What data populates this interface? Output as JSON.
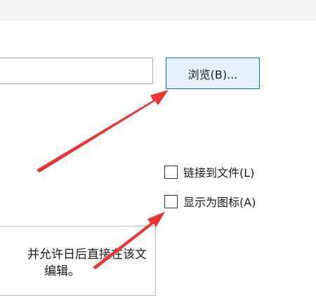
{
  "file_input": {
    "value": ""
  },
  "browse_button": {
    "label": "浏览(B)..."
  },
  "options": [
    {
      "label": "链接到文件(L)",
      "checked": false
    },
    {
      "label": "显示为图标(A)",
      "checked": false
    }
  ],
  "result": {
    "line1": "并允许日后直接在该文",
    "line2": "编辑。"
  },
  "colors": {
    "arrow": "#ee3333",
    "button_border": "#0078d7",
    "button_fill": "#e5f1fb"
  }
}
